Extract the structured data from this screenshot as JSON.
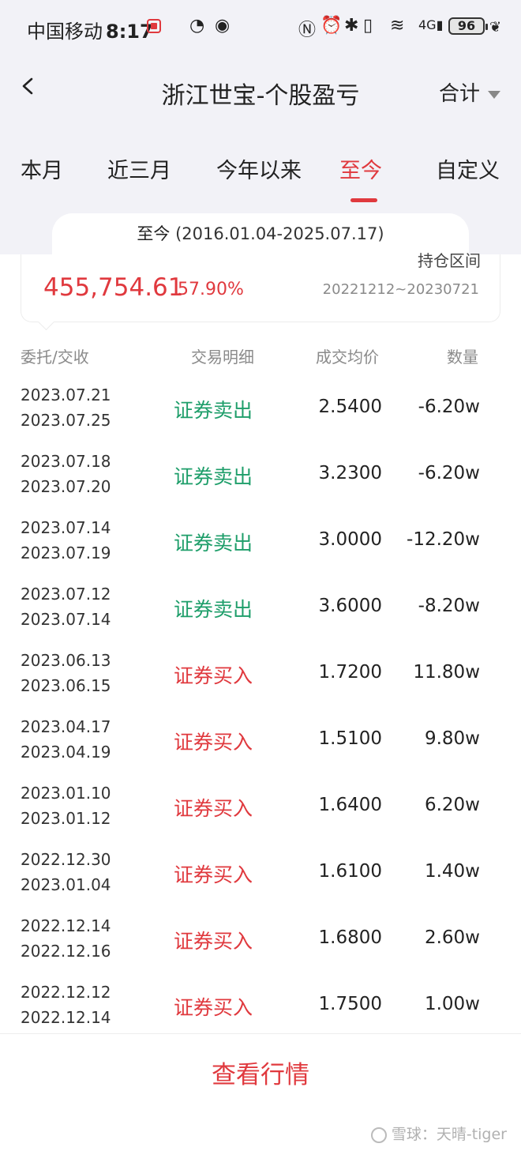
{
  "status_bar": {
    "carrier": "中国移动",
    "time": "8:17",
    "battery": "96"
  },
  "nav": {
    "title": "浙江世宝-个股盈亏",
    "right_label": "合计"
  },
  "tabs": [
    "本月",
    "近三月",
    "今年以来",
    "至今",
    "自定义"
  ],
  "active_tab": "至今",
  "range": {
    "label": "至今",
    "dates": "(2016.01.04-2025.07.17)"
  },
  "summary": {
    "clipped_text": "持仓区间",
    "amount": "455,754.61",
    "percent": "57.90%",
    "period": "20221212~20230721"
  },
  "table": {
    "headers": [
      "委托/交收",
      "交易明细",
      "成交均价",
      "数量"
    ],
    "rows": [
      {
        "d1": "2023.07.21",
        "d2": "2023.07.25",
        "type": "证券卖出",
        "kind": "sell",
        "price": "2.5400",
        "qty": "-6.20w"
      },
      {
        "d1": "2023.07.18",
        "d2": "2023.07.20",
        "type": "证券卖出",
        "kind": "sell",
        "price": "3.2300",
        "qty": "-6.20w"
      },
      {
        "d1": "2023.07.14",
        "d2": "2023.07.19",
        "type": "证券卖出",
        "kind": "sell",
        "price": "3.0000",
        "qty": "-12.20w"
      },
      {
        "d1": "2023.07.12",
        "d2": "2023.07.14",
        "type": "证券卖出",
        "kind": "sell",
        "price": "3.6000",
        "qty": "-8.20w"
      },
      {
        "d1": "2023.06.13",
        "d2": "2023.06.15",
        "type": "证券买入",
        "kind": "buy",
        "price": "1.7200",
        "qty": "11.80w"
      },
      {
        "d1": "2023.04.17",
        "d2": "2023.04.19",
        "type": "证券买入",
        "kind": "buy",
        "price": "1.5100",
        "qty": "9.80w"
      },
      {
        "d1": "2023.01.10",
        "d2": "2023.01.12",
        "type": "证券买入",
        "kind": "buy",
        "price": "1.6400",
        "qty": "6.20w"
      },
      {
        "d1": "2022.12.30",
        "d2": "2023.01.04",
        "type": "证券买入",
        "kind": "buy",
        "price": "1.6100",
        "qty": "1.40w"
      },
      {
        "d1": "2022.12.14",
        "d2": "2022.12.16",
        "type": "证券买入",
        "kind": "buy",
        "price": "1.6800",
        "qty": "2.60w"
      },
      {
        "d1": "2022.12.12",
        "d2": "2022.12.14",
        "type": "证券买入",
        "kind": "buy",
        "price": "1.7500",
        "qty": "1.00w"
      }
    ]
  },
  "bottom": {
    "button_label": "查看行情",
    "watermark": "雪球：天晴-tiger"
  },
  "colors": {
    "accent_red": "#e0393e",
    "sell_green": "#1e9e6a",
    "header_bg": "#f2f2f7"
  }
}
